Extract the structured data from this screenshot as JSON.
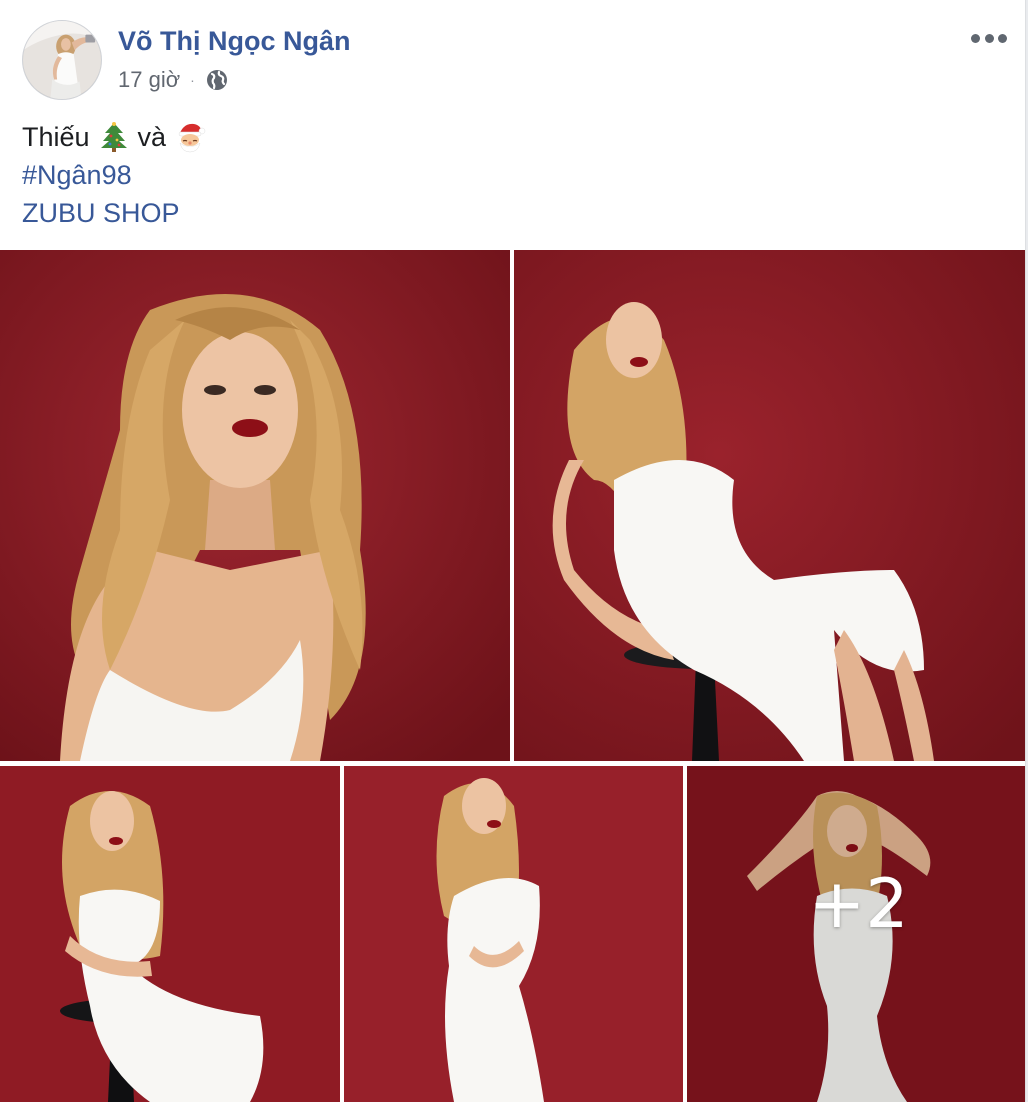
{
  "post": {
    "author": "Võ Thị Ngọc Ngân",
    "time": "17 giờ",
    "privacy_icon": "globe-icon",
    "more_icon": "more-options-icon",
    "text": {
      "line1_start": "Thiếu",
      "line1_emoji1": "christmas-tree-emoji",
      "line1_middle": "và",
      "line1_emoji2": "santa-claus-emoji",
      "hashtag": "#Ngân98",
      "link": "ZUBU SHOP"
    },
    "photos": {
      "count_visible": 5,
      "more_count_label": "+2",
      "background_color": "#8e1c24",
      "dress_color": "#f7f7f5",
      "hair_color": "#d6a766"
    }
  }
}
